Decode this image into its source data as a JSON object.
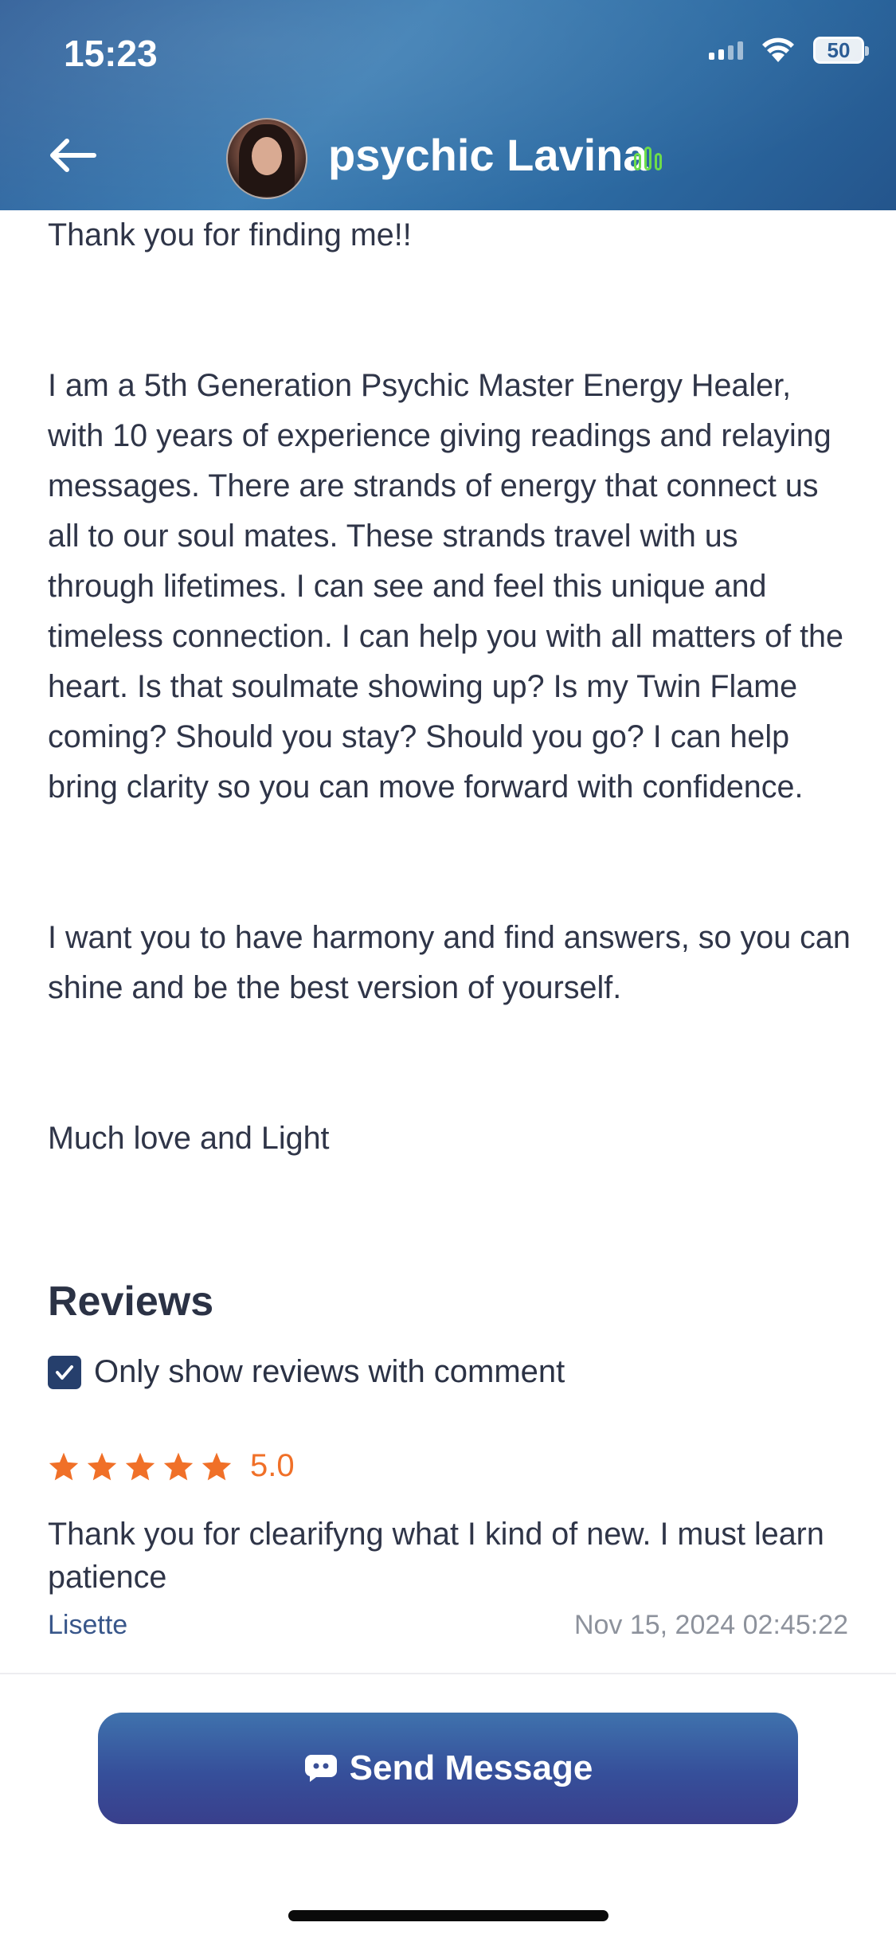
{
  "status_bar": {
    "time": "15:23",
    "battery": "50",
    "icons": [
      "cellular-signal-icon",
      "wifi-icon",
      "battery-icon"
    ]
  },
  "header": {
    "title": "psychic Lavina",
    "back_icon": "back-arrow-icon",
    "status_icon": "online-status-icon",
    "colors": {
      "gradient_start": "#2f5e98",
      "gradient_end": "#24558c",
      "status_green": "#6ddc4a"
    }
  },
  "bio": {
    "paragraphs": [
      "Thank you for finding me!!",
      "I am a 5th Generation Psychic Master Energy Healer, with 10 years of experience giving readings and relaying messages. There are strands of energy that connect us all to our soul mates. These strands travel with us through lifetimes. I can see and feel this unique and timeless connection. I can help you with all matters of the heart. Is that soulmate showing up? Is my Twin Flame coming? Should you stay? Should you go? I can help bring clarity so you can move forward with confidence.",
      "I want you to have harmony and find answers, so you can shine and be the best version of yourself.",
      "Much love and Light"
    ]
  },
  "reviews": {
    "title": "Reviews",
    "filter_label": "Only show reviews with comment",
    "filter_checked": true,
    "items": [
      {
        "stars": 5,
        "rating": "5.0",
        "text": "Thank you for clearifyng what I kind of new. I must learn patience",
        "author": "Lisette",
        "date": "Nov 15, 2024 02:45:22"
      }
    ],
    "colors": {
      "star": "#f07028",
      "checkbox": "#263f6c"
    }
  },
  "footer": {
    "send_label": "Send Message",
    "send_icon": "chat-bubble-icon"
  }
}
